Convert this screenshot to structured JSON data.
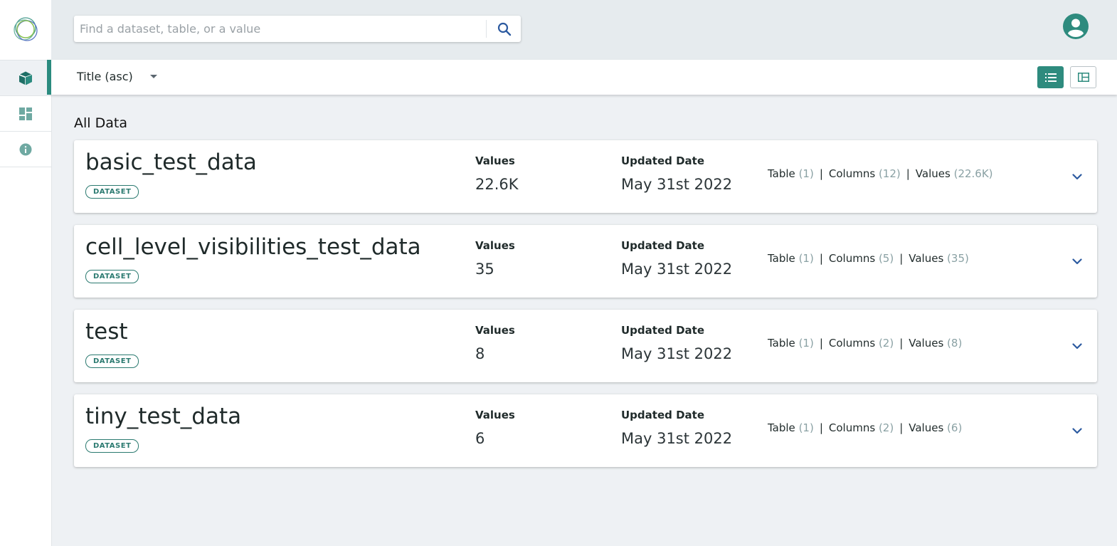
{
  "search": {
    "placeholder": "Find a dataset, table, or a value"
  },
  "toolbar": {
    "sort_label": "Title (asc)"
  },
  "section": {
    "title": "All Data"
  },
  "datasets": [
    {
      "title": "basic_test_data",
      "badge": "DATASET",
      "values_label": "Values",
      "values": "22.6K",
      "date_label": "Updated Date",
      "date": "May 31st 2022",
      "summary": {
        "table_label": "Table",
        "table_count": "(1)",
        "columns_label": "Columns",
        "columns_count": "(12)",
        "values_label": "Values",
        "values_count": "(22.6K)"
      }
    },
    {
      "title": "cell_level_visibilities_test_data",
      "badge": "DATASET",
      "values_label": "Values",
      "values": "35",
      "date_label": "Updated Date",
      "date": "May 31st 2022",
      "summary": {
        "table_label": "Table",
        "table_count": "(1)",
        "columns_label": "Columns",
        "columns_count": "(5)",
        "values_label": "Values",
        "values_count": "(35)"
      }
    },
    {
      "title": "test",
      "badge": "DATASET",
      "values_label": "Values",
      "values": "8",
      "date_label": "Updated Date",
      "date": "May 31st 2022",
      "summary": {
        "table_label": "Table",
        "table_count": "(1)",
        "columns_label": "Columns",
        "columns_count": "(2)",
        "values_label": "Values",
        "values_count": "(8)"
      }
    },
    {
      "title": "tiny_test_data",
      "badge": "DATASET",
      "values_label": "Values",
      "values": "6",
      "date_label": "Updated Date",
      "date": "May 31st 2022",
      "summary": {
        "table_label": "Table",
        "table_count": "(1)",
        "columns_label": "Columns",
        "columns_count": "(2)",
        "values_label": "Values",
        "values_count": "(6)"
      }
    }
  ],
  "icons": {
    "logo": "logo-rings-icon",
    "sidebar": [
      "cube-icon",
      "dashboard-icon",
      "info-icon"
    ],
    "search": "search-icon",
    "avatar": "user-avatar-icon",
    "sort": "caret-down-icon",
    "view_list": "list-view-icon",
    "view_grid": "grid-view-icon",
    "expand": "chevron-down-icon"
  },
  "colors": {
    "accent": "#2e8b7e",
    "link_blue": "#2c5aa0",
    "muted_count": "#8aa1a4"
  }
}
